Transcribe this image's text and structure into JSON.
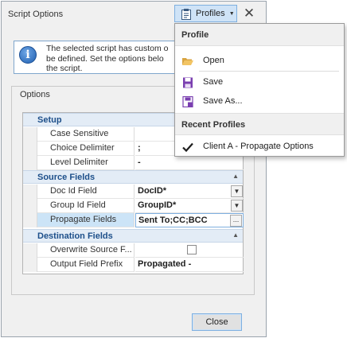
{
  "window": {
    "title": "Script Options",
    "profiles_label": "Profiles",
    "close_glyph": "✕"
  },
  "info": {
    "message": "The selected script has custom o\nbe defined. Set the options belo\nthe script."
  },
  "options_group": {
    "title": "Options"
  },
  "grid": {
    "categories": {
      "setup": "Setup",
      "source": "Source Fields",
      "destination": "Destination Fields"
    },
    "rows": {
      "case_sensitive": {
        "name": "Case Sensitive",
        "value": ""
      },
      "choice_delimiter": {
        "name": "Choice Delimiter",
        "value": ";"
      },
      "level_delimiter": {
        "name": "Level Delimiter",
        "value": "-"
      },
      "doc_id_field": {
        "name": "Doc Id Field",
        "value": "DocID*"
      },
      "group_id_field": {
        "name": "Group Id Field",
        "value": "GroupID*"
      },
      "propagate_fields": {
        "name": "Propagate Fields",
        "value": "Sent To;CC;BCC"
      },
      "overwrite_source": {
        "name": "Overwrite Source F...",
        "checked": false
      },
      "output_prefix": {
        "name": "Output Field Prefix",
        "value": "Propagated -"
      }
    }
  },
  "buttons": {
    "close": "Close"
  },
  "profiles_menu": {
    "header": "Profile",
    "open": "Open",
    "save": "Save",
    "save_as": "Save As...",
    "recent_header": "Recent Profiles",
    "recent_items": [
      "Client A - Propagate Options"
    ]
  },
  "colors": {
    "accent": "#cfe3f7",
    "accent_border": "#7fb0e0",
    "category_text": "#1d4f8a",
    "save_icon": "#7a3fb0"
  },
  "icons": {
    "profiles": "clipboard-icon",
    "info": "info-icon",
    "open": "folder-open-icon",
    "save": "floppy-icon",
    "save_as": "floppy-as-icon",
    "recent": "checkmark-icon"
  }
}
